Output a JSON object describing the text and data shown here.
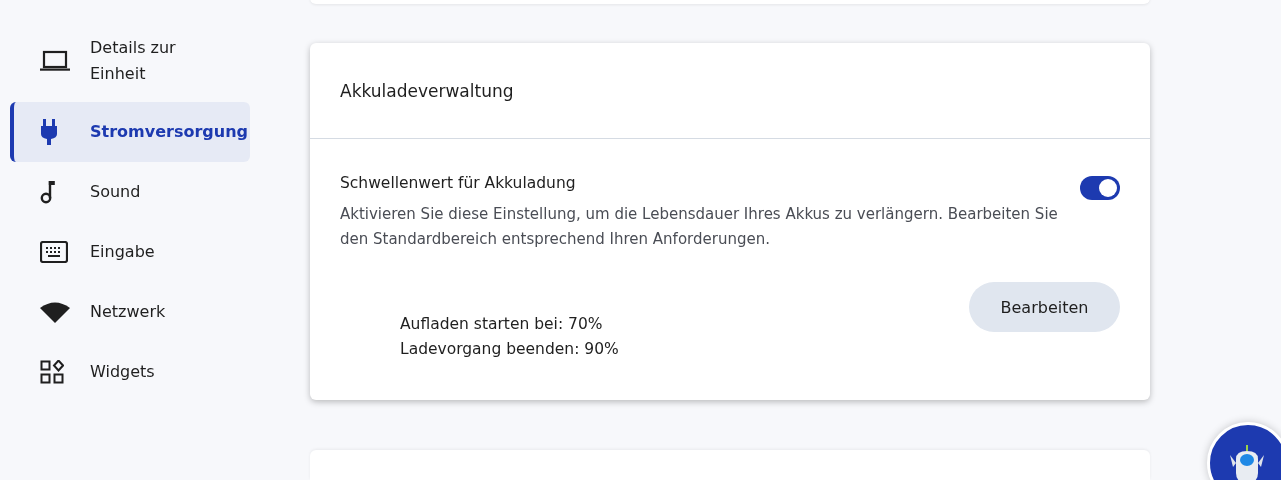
{
  "sidebar": {
    "items": [
      {
        "label": "Details zur Einheit",
        "kind": "laptop",
        "selected": false
      },
      {
        "label": "Stromversorgung",
        "kind": "plug",
        "selected": true
      },
      {
        "label": "Sound",
        "kind": "note",
        "selected": false
      },
      {
        "label": "Eingabe",
        "kind": "keyboard",
        "selected": false
      },
      {
        "label": "Netzwerk",
        "kind": "wifi",
        "selected": false
      },
      {
        "label": "Widgets",
        "kind": "widgets",
        "selected": false
      }
    ]
  },
  "card": {
    "title": "Akkuladeverwaltung",
    "setting": {
      "title": "Schwellenwert für Akkuladung",
      "on": true,
      "description": "Aktivieren Sie diese Einstellung, um die Lebensdauer Ihres Akkus zu verlängern. Bearbeiten Sie den Standardbereich entsprechend Ihren Anforderungen.",
      "values": [
        "Aufladen starten bei: 70%",
        "Ladevorgang beenden: 90%"
      ],
      "button": "Bearbeiten"
    }
  }
}
